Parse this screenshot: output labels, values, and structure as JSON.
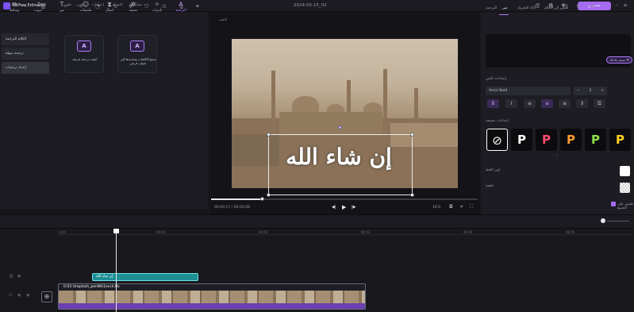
{
  "app": {
    "name": "HitPaw Edimakor",
    "date": "2024-05-15_02",
    "export_label": "تصدير"
  },
  "menu": [
    "ملف",
    "تحرير",
    "إعدادات",
    "الشراء",
    "مساعدة"
  ],
  "tools": [
    {
      "label": "وسائط",
      "icon": "media-icon"
    },
    {
      "label": "صوت",
      "icon": "audio-icon"
    },
    {
      "label": "نص",
      "icon": "text-icon"
    },
    {
      "label": "ملصقات",
      "icon": "sticker-icon"
    },
    {
      "label": "انتقال",
      "icon": "transition-icon"
    },
    {
      "label": "تصفية",
      "icon": "filter-icon"
    },
    {
      "label": "تأثيرات",
      "icon": "effect-icon"
    },
    {
      "label": "الترجمة",
      "icon": "subtitle-icon"
    }
  ],
  "leftnav": [
    "الكلام الترجمة",
    "ترجمة سهلة",
    "إعداد ترجمات"
  ],
  "cards": [
    {
      "badge": "A",
      "text": "أضف ترجمة فرعية"
    },
    {
      "badge": "A",
      "text": "مسح الكلمات وتحديدها إلى عنوان فرعي"
    }
  ],
  "preview": {
    "label": "لاعب",
    "caption": "إن شاء الله",
    "current_time": "00:00:17",
    "total_time": "00:03:08",
    "ratio": "16:9",
    "progress": 0.19
  },
  "right": {
    "tabs": [
      "النص إلى الكلام",
      "ذكاء التحريك",
      "نص",
      "الترجمة"
    ],
    "active_tab": "نص",
    "ai_button": "صمم بالذكاء AI",
    "basic_settings": "إعدادات النص",
    "font": "Amiri Bold",
    "font_size": "2",
    "presets_label": "إعدادات مسبقة",
    "presets": [
      {
        "glyph": "P",
        "color": "#ffffff"
      },
      {
        "glyph": "P",
        "color": "#ff4d6d"
      },
      {
        "glyph": "P",
        "color": "#ff9a2e"
      },
      {
        "glyph": "P",
        "color": "#8be04e"
      },
      {
        "glyph": "P",
        "color": "#ffd21f"
      }
    ],
    "font_color_label": "لون الخط",
    "background_label": "خلفية",
    "apply_all_label": "تطبيق على الجميع",
    "font_color": "#ffffff"
  },
  "timeline": {
    "ticks": [
      "0:00",
      "00:01",
      "00:02",
      "00:03",
      "00:04",
      "00:05"
    ],
    "subtitle_clip": "إن شاء الله",
    "video_clip": "0:03 Unsplash_penWh1ecch.ffx"
  },
  "colors": {
    "accent": "#a56bf0",
    "subtitle_clip": "#1f8f96",
    "audio": "#6a3fb0"
  }
}
